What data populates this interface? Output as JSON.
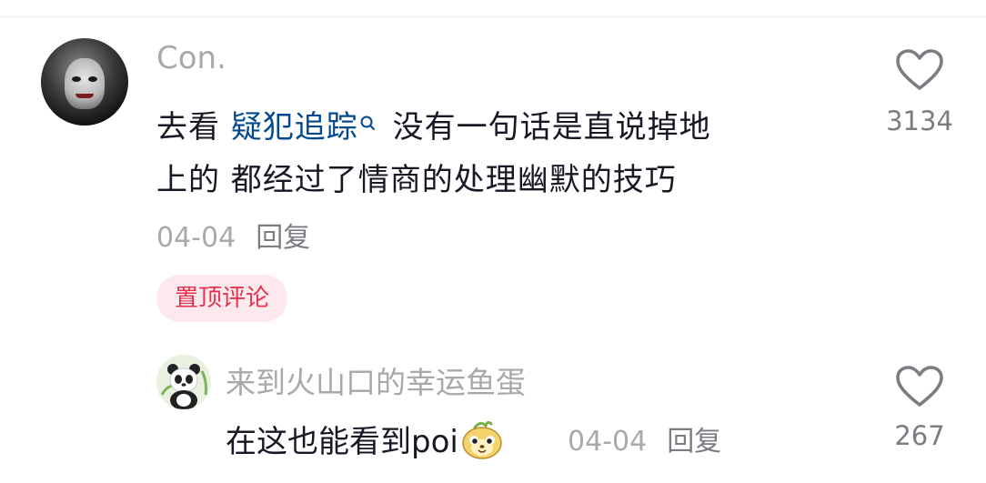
{
  "main_comment": {
    "username": "Con.",
    "text_prefix": "去看 ",
    "keyword": "疑犯追踪",
    "text_suffix": " 没有一句话是直说掉地",
    "text_line2": "上的 都经过了情商的处理幽默的技巧",
    "date": "04-04",
    "reply_label": "回复",
    "pinned_label": "置顶评论",
    "like_count": "3134"
  },
  "reply_comment": {
    "username": "来到火山口的幸运鱼蛋",
    "text": "在这也能看到poi",
    "date": "04-04",
    "reply_label": "回复",
    "like_count": "267"
  },
  "icons": {
    "like": "heart-outline-icon",
    "keyword_search": "search-icon",
    "emoji": "sticker-emoji-icon"
  },
  "colors": {
    "keyword_link": "#04498d",
    "pinned_text": "#e5334f",
    "pinned_bg": "#fde9ed",
    "muted_text": "#a8a9ad"
  }
}
